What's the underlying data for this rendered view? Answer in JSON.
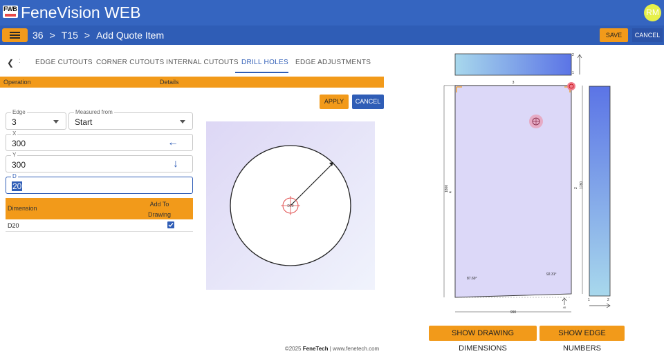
{
  "app": {
    "logo_text": "FWB",
    "title": "FeneVision WEB",
    "avatar_initials": "RM"
  },
  "nav": {
    "crumbs": [
      "36",
      "T15",
      "Add Quote Item"
    ],
    "separator": ">",
    "save_label": "SAVE",
    "cancel_label": "CANCEL"
  },
  "tabs": {
    "back_icon": "chevron-left-icon",
    "dots": ":",
    "items": [
      "EDGE CUTOUTS",
      "CORNER CUTOUTS",
      "INTERNAL CUTOUTS",
      "DRILL HOLES",
      "EDGE ADJUSTMENTS"
    ],
    "active": "DRILL HOLES"
  },
  "ops_table": {
    "headers": [
      "Operation",
      "Details"
    ]
  },
  "actions": {
    "apply_label": "APPLY",
    "cancel_label": "CANCEL"
  },
  "form": {
    "edge": {
      "label": "Edge",
      "value": "3"
    },
    "measured_from": {
      "label": "Measured from",
      "value": "Start"
    },
    "x": {
      "label": "X",
      "value": "300",
      "icon": "arrow-left-icon"
    },
    "y": {
      "label": "Y",
      "value": "300",
      "icon": "arrow-down-icon"
    },
    "d": {
      "label": "D",
      "value": "20"
    }
  },
  "dim_table": {
    "headers": [
      "Dimension",
      "Add To",
      "Drawing"
    ],
    "rows": [
      {
        "dimension": "D20",
        "add_to_drawing": true
      }
    ]
  },
  "preview": {
    "hole_label": "D20"
  },
  "drawing": {
    "top_width_label": "3",
    "left_height_label": "1800",
    "left_edge_label": "4",
    "right_edge_label": "2",
    "right_height_label": "1780",
    "bottom_width_label": "990",
    "bottom_offset_label": "40",
    "angle_left": "87.69°",
    "angle_right": "92.31°",
    "top_strip_numbers": [
      "2",
      "1"
    ],
    "side_strip_numbers": [
      "1",
      "2"
    ],
    "panel_color": "#dcd8f8",
    "strip_start_color": "#a8d8ec",
    "strip_end_color": "#5b74e6"
  },
  "bottom_buttons": {
    "dimensions_label": "SHOW DRAWING DIMENSIONS",
    "edge_numbers_label": "SHOW EDGE NUMBERS"
  },
  "footer": {
    "copyright": "©2025",
    "brand": "FeneTech",
    "site": "| www.fenetech.com"
  },
  "colors": {
    "primary": "#3565c0",
    "accent": "#f29a1a"
  }
}
